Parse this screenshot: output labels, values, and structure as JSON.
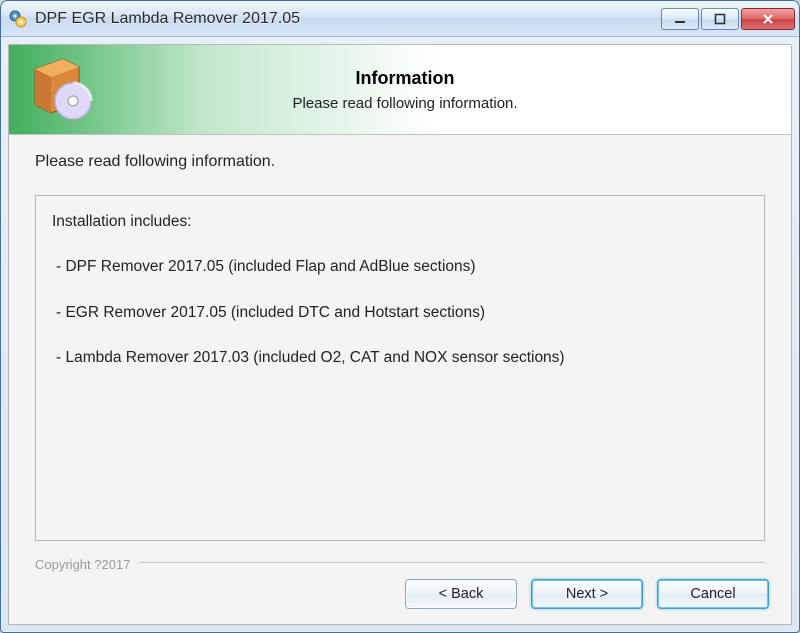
{
  "window": {
    "title": "DPF EGR Lambda Remover 2017.05"
  },
  "header": {
    "title": "Information",
    "subtitle": "Please read following information."
  },
  "body": {
    "intro": "Please read following information.",
    "includes_label": "Installation includes:",
    "items": [
      " - DPF Remover 2017.05 (included Flap and AdBlue sections)",
      " - EGR Remover 2017.05 (included DTC and Hotstart sections)",
      " - Lambda Remover 2017.03 (included O2, CAT and NOX sensor sections)"
    ]
  },
  "copyright": "Copyright ?2017",
  "buttons": {
    "back": "< Back",
    "next": "Next >",
    "cancel": "Cancel"
  },
  "icons": {
    "app": "gear-disc-icon",
    "minimize": "minimize-icon",
    "maximize": "maximize-icon",
    "close": "close-icon",
    "header": "install-box-cd-icon"
  }
}
